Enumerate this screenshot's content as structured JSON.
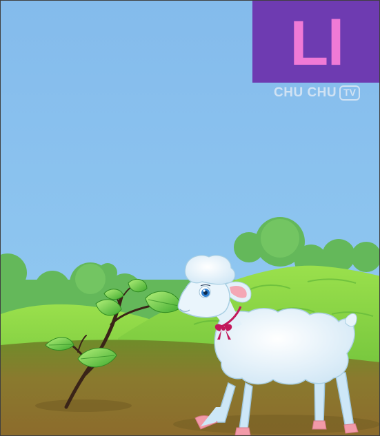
{
  "letter": {
    "text": "Ll",
    "box_color": "#6e3bb1",
    "text_color": "#f07ad6"
  },
  "watermark": {
    "brand": "CHU CHU",
    "tv_badge": "TV"
  },
  "scene": {
    "sky_color": "#8ec3ef",
    "hill_color": "#7fcf3f",
    "ground_color": "#8f7d2e",
    "animal": "lamb",
    "plant": "sapling"
  }
}
